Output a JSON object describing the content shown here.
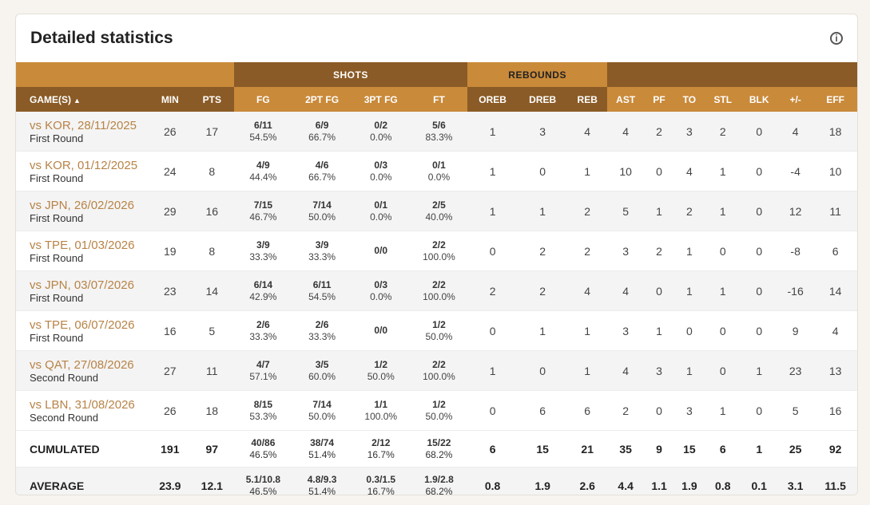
{
  "title": "Detailed statistics",
  "groups": {
    "shots": "SHOTS",
    "rebounds": "REBOUNDS"
  },
  "columns": {
    "game": "GAME(S)",
    "sort": "▲",
    "min": "MIN",
    "pts": "PTS",
    "fg": "FG",
    "fg2": "2PT FG",
    "fg3": "3PT FG",
    "ft": "FT",
    "oreb": "OREB",
    "dreb": "DREB",
    "reb": "REB",
    "ast": "AST",
    "pf": "PF",
    "to": "TO",
    "stl": "STL",
    "blk": "BLK",
    "pm": "+/-",
    "eff": "EFF"
  },
  "games": [
    {
      "opp": "vs KOR, 28/11/2025",
      "round": "First Round",
      "min": "26",
      "pts": "17",
      "fg": [
        "6/11",
        "54.5%"
      ],
      "fg2": [
        "6/9",
        "66.7%"
      ],
      "fg3": [
        "0/2",
        "0.0%"
      ],
      "ft": [
        "5/6",
        "83.3%"
      ],
      "oreb": "1",
      "dreb": "3",
      "reb": "4",
      "ast": "4",
      "pf": "2",
      "to": "3",
      "stl": "2",
      "blk": "0",
      "pm": "4",
      "eff": "18"
    },
    {
      "opp": "vs KOR, 01/12/2025",
      "round": "First Round",
      "min": "24",
      "pts": "8",
      "fg": [
        "4/9",
        "44.4%"
      ],
      "fg2": [
        "4/6",
        "66.7%"
      ],
      "fg3": [
        "0/3",
        "0.0%"
      ],
      "ft": [
        "0/1",
        "0.0%"
      ],
      "oreb": "1",
      "dreb": "0",
      "reb": "1",
      "ast": "10",
      "pf": "0",
      "to": "4",
      "stl": "1",
      "blk": "0",
      "pm": "-4",
      "eff": "10"
    },
    {
      "opp": "vs JPN, 26/02/2026",
      "round": "First Round",
      "min": "29",
      "pts": "16",
      "fg": [
        "7/15",
        "46.7%"
      ],
      "fg2": [
        "7/14",
        "50.0%"
      ],
      "fg3": [
        "0/1",
        "0.0%"
      ],
      "ft": [
        "2/5",
        "40.0%"
      ],
      "oreb": "1",
      "dreb": "1",
      "reb": "2",
      "ast": "5",
      "pf": "1",
      "to": "2",
      "stl": "1",
      "blk": "0",
      "pm": "12",
      "eff": "11"
    },
    {
      "opp": "vs TPE, 01/03/2026",
      "round": "First Round",
      "min": "19",
      "pts": "8",
      "fg": [
        "3/9",
        "33.3%"
      ],
      "fg2": [
        "3/9",
        "33.3%"
      ],
      "fg3": [
        "0/0",
        ""
      ],
      "ft": [
        "2/2",
        "100.0%"
      ],
      "oreb": "0",
      "dreb": "2",
      "reb": "2",
      "ast": "3",
      "pf": "2",
      "to": "1",
      "stl": "0",
      "blk": "0",
      "pm": "-8",
      "eff": "6"
    },
    {
      "opp": "vs JPN, 03/07/2026",
      "round": "First Round",
      "min": "23",
      "pts": "14",
      "fg": [
        "6/14",
        "42.9%"
      ],
      "fg2": [
        "6/11",
        "54.5%"
      ],
      "fg3": [
        "0/3",
        "0.0%"
      ],
      "ft": [
        "2/2",
        "100.0%"
      ],
      "oreb": "2",
      "dreb": "2",
      "reb": "4",
      "ast": "4",
      "pf": "0",
      "to": "1",
      "stl": "1",
      "blk": "0",
      "pm": "-16",
      "eff": "14"
    },
    {
      "opp": "vs TPE, 06/07/2026",
      "round": "First Round",
      "min": "16",
      "pts": "5",
      "fg": [
        "2/6",
        "33.3%"
      ],
      "fg2": [
        "2/6",
        "33.3%"
      ],
      "fg3": [
        "0/0",
        ""
      ],
      "ft": [
        "1/2",
        "50.0%"
      ],
      "oreb": "0",
      "dreb": "1",
      "reb": "1",
      "ast": "3",
      "pf": "1",
      "to": "0",
      "stl": "0",
      "blk": "0",
      "pm": "9",
      "eff": "4"
    },
    {
      "opp": "vs QAT, 27/08/2026",
      "round": "Second Round",
      "min": "27",
      "pts": "11",
      "fg": [
        "4/7",
        "57.1%"
      ],
      "fg2": [
        "3/5",
        "60.0%"
      ],
      "fg3": [
        "1/2",
        "50.0%"
      ],
      "ft": [
        "2/2",
        "100.0%"
      ],
      "oreb": "1",
      "dreb": "0",
      "reb": "1",
      "ast": "4",
      "pf": "3",
      "to": "1",
      "stl": "0",
      "blk": "1",
      "pm": "23",
      "eff": "13"
    },
    {
      "opp": "vs LBN, 31/08/2026",
      "round": "Second Round",
      "min": "26",
      "pts": "18",
      "fg": [
        "8/15",
        "53.3%"
      ],
      "fg2": [
        "7/14",
        "50.0%"
      ],
      "fg3": [
        "1/1",
        "100.0%"
      ],
      "ft": [
        "1/2",
        "50.0%"
      ],
      "oreb": "0",
      "dreb": "6",
      "reb": "6",
      "ast": "2",
      "pf": "0",
      "to": "3",
      "stl": "1",
      "blk": "0",
      "pm": "5",
      "eff": "16"
    }
  ],
  "cumulated": {
    "label": "CUMULATED",
    "min": "191",
    "pts": "97",
    "fg": [
      "40/86",
      "46.5%"
    ],
    "fg2": [
      "38/74",
      "51.4%"
    ],
    "fg3": [
      "2/12",
      "16.7%"
    ],
    "ft": [
      "15/22",
      "68.2%"
    ],
    "oreb": "6",
    "dreb": "15",
    "reb": "21",
    "ast": "35",
    "pf": "9",
    "to": "15",
    "stl": "6",
    "blk": "1",
    "pm": "25",
    "eff": "92"
  },
  "average": {
    "label": "AVERAGE",
    "min": "23.9",
    "pts": "12.1",
    "fg": [
      "5.1/10.8",
      "46.5%"
    ],
    "fg2": [
      "4.8/9.3",
      "51.4%"
    ],
    "fg3": [
      "0.3/1.5",
      "16.7%"
    ],
    "ft": [
      "1.9/2.8",
      "68.2%"
    ],
    "oreb": "0.8",
    "dreb": "1.9",
    "reb": "2.6",
    "ast": "4.4",
    "pf": "1.1",
    "to": "1.9",
    "stl": "0.8",
    "blk": "0.1",
    "pm": "3.1",
    "eff": "11.5"
  },
  "icons": {
    "info": "info-icon"
  },
  "colors": {
    "header_dark": "#8a5b26",
    "header_light": "#c98a3a",
    "link": "#b88346"
  }
}
